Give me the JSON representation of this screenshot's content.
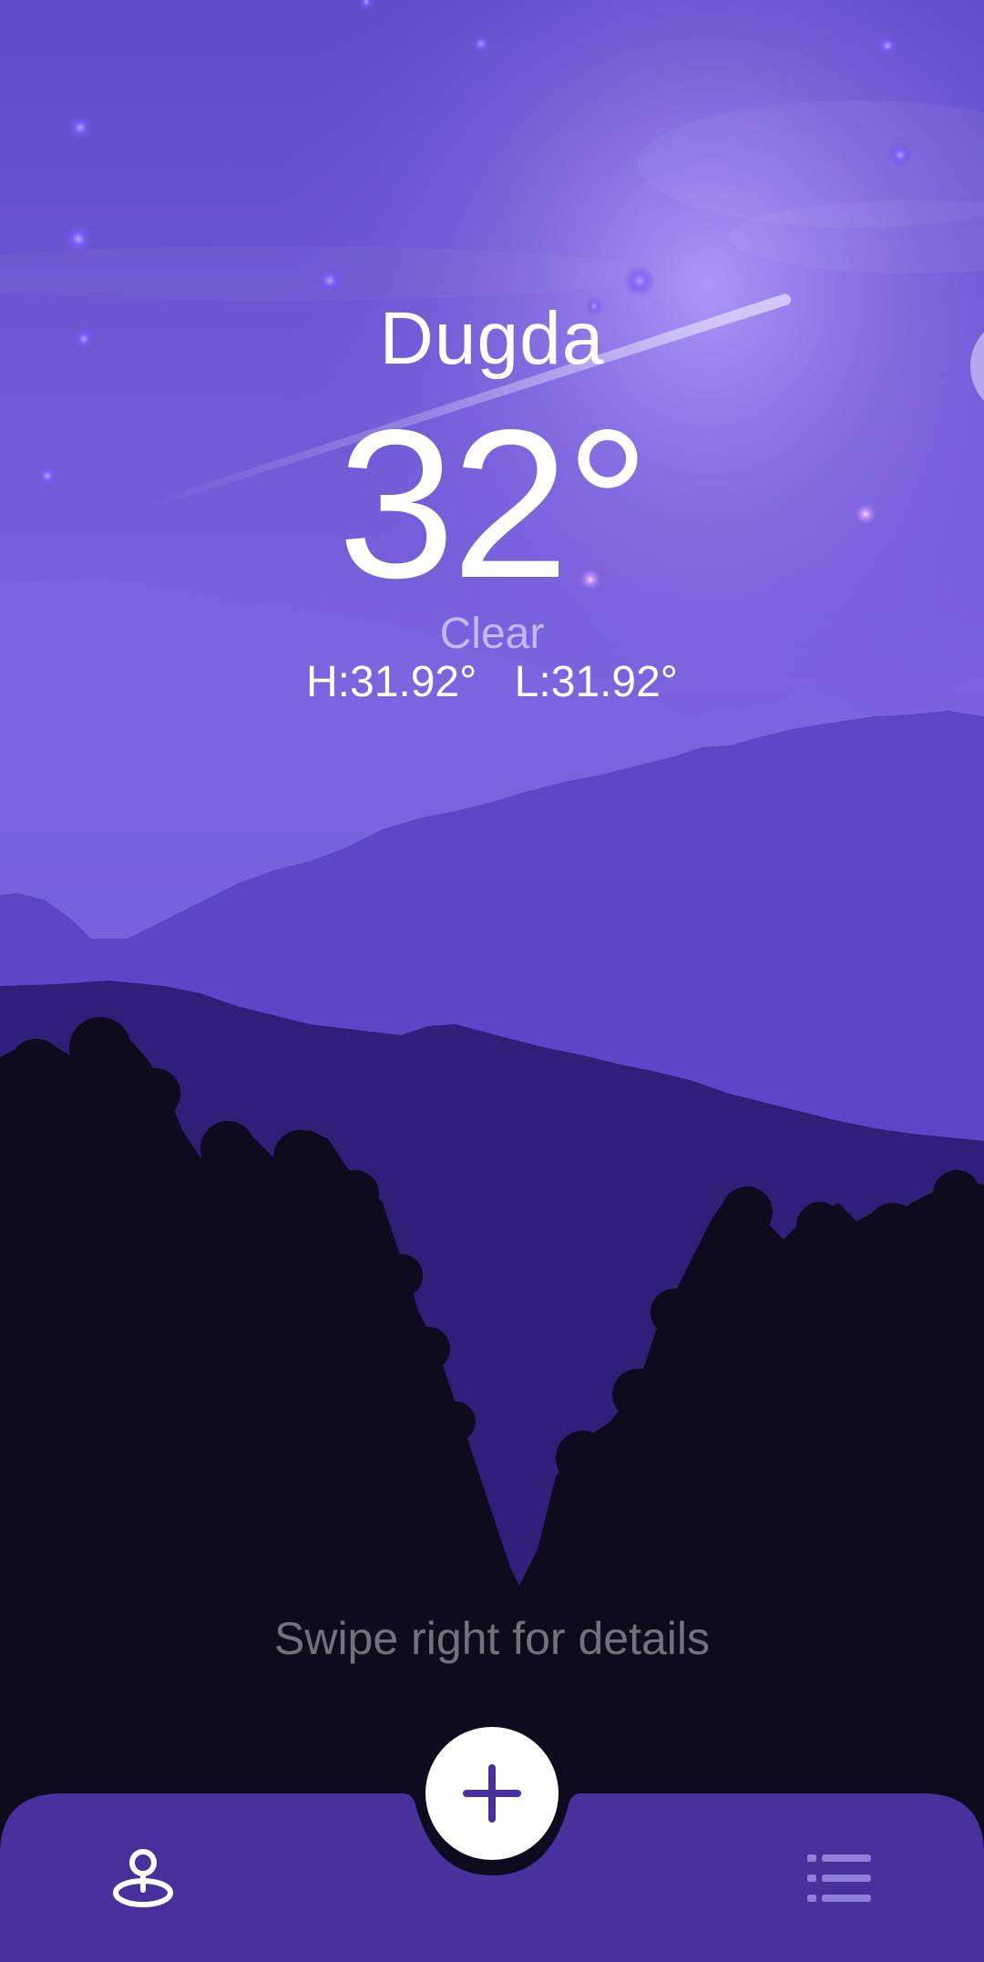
{
  "weather": {
    "city": "Dugda",
    "temperature": "32°",
    "condition": "Clear",
    "high": "H:31.92°",
    "low": "L:31.92°"
  },
  "hint": "Swipe right for details",
  "navbar": {
    "left_icon": "location-pin-icon",
    "center_icon": "plus-icon",
    "right_icon": "list-icon"
  },
  "colors": {
    "sky_top": "#5f4bc8",
    "sky_glow": "#a690f5",
    "navbar": "#48319d",
    "forest": "#0f0b1e",
    "fab": "#ffffff",
    "accent": "#48319d"
  }
}
